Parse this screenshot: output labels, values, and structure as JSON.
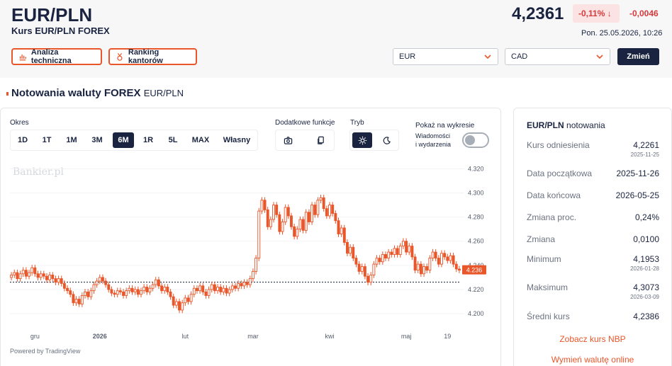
{
  "header": {
    "title": "EUR/PLN",
    "subtitle": "Kurs EUR/PLN FOREX",
    "price": "4,2361",
    "change_pct": "-0,11% ↓",
    "change_abs": "-0,0046",
    "datetime": "Pon. 25.05.2026, 10:26",
    "btn_technical": "Analiza techniczna",
    "btn_ranking": "Ranking kantorów",
    "select_from": "EUR",
    "select_to": "CAD",
    "btn_change": "Zmień"
  },
  "section": {
    "title": "Notowania waluty FOREX",
    "pair": "EUR/PLN"
  },
  "controls": {
    "okres_label": "Okres",
    "periods": [
      "1D",
      "1T",
      "1M",
      "3M",
      "6M",
      "1R",
      "5L",
      "MAX",
      "Własny"
    ],
    "active_period": "6M",
    "extra_label": "Dodatkowe funkcje",
    "mode_label": "Tryb",
    "show_label": "Pokaż na wykresie",
    "news_label_1": "Wiadomości",
    "news_label_2": "i wydarzenia"
  },
  "chart_data": {
    "type": "candlestick",
    "watermark": "Bankier.pl",
    "y_ticks": [
      "4.320",
      "4.300",
      "4.280",
      "4.260",
      "4.240",
      "4.220",
      "4.200"
    ],
    "ylim": [
      4.193,
      4.322
    ],
    "x_ticks": [
      "gru",
      "2026",
      "lut",
      "mar",
      "kwi",
      "maj",
      "19"
    ],
    "x_tick_index": [
      8,
      30,
      59,
      82,
      108,
      134,
      148
    ],
    "last_price_label": "4.236",
    "reference_line": 4.2261,
    "colors": {
      "candle": "#e8562a",
      "price_label": "#e8562a"
    },
    "closes": [
      4.232,
      4.234,
      4.229,
      4.233,
      4.236,
      4.231,
      4.234,
      4.238,
      4.233,
      4.23,
      4.233,
      4.231,
      4.228,
      4.232,
      4.229,
      4.226,
      4.229,
      4.225,
      4.221,
      4.219,
      4.216,
      4.209,
      4.212,
      4.208,
      4.215,
      4.218,
      4.214,
      4.219,
      4.224,
      4.227,
      4.23,
      4.227,
      4.224,
      4.22,
      4.217,
      4.216,
      4.219,
      4.218,
      4.215,
      4.219,
      4.221,
      4.218,
      4.22,
      4.216,
      4.219,
      4.222,
      4.218,
      4.221,
      4.224,
      4.228,
      4.223,
      4.219,
      4.222,
      4.218,
      4.214,
      4.207,
      4.21,
      4.203,
      4.209,
      4.213,
      4.21,
      4.216,
      4.221,
      4.219,
      4.223,
      4.218,
      4.215,
      4.22,
      4.224,
      4.219,
      4.222,
      4.218,
      4.221,
      4.217,
      4.22,
      4.223,
      4.221,
      4.225,
      4.223,
      4.226,
      4.224,
      4.229,
      4.235,
      4.246,
      4.285,
      4.294,
      4.286,
      4.272,
      4.278,
      4.29,
      4.282,
      4.268,
      4.276,
      4.288,
      4.281,
      4.272,
      4.264,
      4.27,
      4.278,
      4.269,
      4.284,
      4.276,
      4.29,
      4.282,
      4.294,
      4.296,
      4.287,
      4.281,
      4.29,
      4.283,
      4.277,
      4.266,
      4.271,
      4.259,
      4.25,
      4.255,
      4.246,
      4.241,
      4.235,
      4.239,
      4.231,
      4.226,
      4.232,
      4.241,
      4.246,
      4.243,
      4.249,
      4.246,
      4.251,
      4.249,
      4.254,
      4.249,
      4.256,
      4.26,
      4.251,
      4.256,
      4.247,
      4.236,
      4.241,
      4.233,
      4.239,
      4.236,
      4.246,
      4.251,
      4.246,
      4.241,
      4.25,
      4.247,
      4.244,
      4.248,
      4.241,
      4.237,
      4.236
    ]
  },
  "powered_by": "Powered by TradingView",
  "side": {
    "title_pair": "EUR/PLN",
    "title_rest": "notowania",
    "rows": [
      {
        "label": "Kurs odniesienia",
        "value": "4,2261",
        "date": "2025-11-25"
      },
      {
        "label": "Data początkowa",
        "value": "2025-11-26"
      },
      {
        "label": "Data końcowa",
        "value": "2026-05-25"
      },
      {
        "label": "Zmiana proc.",
        "value": "0,24%"
      },
      {
        "label": "Zmiana",
        "value": "0,0100"
      },
      {
        "label": "Minimum",
        "value": "4,1953",
        "date": "2026-01-28"
      },
      {
        "label": "Maksimum",
        "value": "4,3073",
        "date": "2026-03-09"
      },
      {
        "label": "Średni kurs",
        "value": "4,2386"
      }
    ],
    "link_nbp": "Zobacz kurs NBP",
    "link_exchange": "Wymień walutę online"
  }
}
